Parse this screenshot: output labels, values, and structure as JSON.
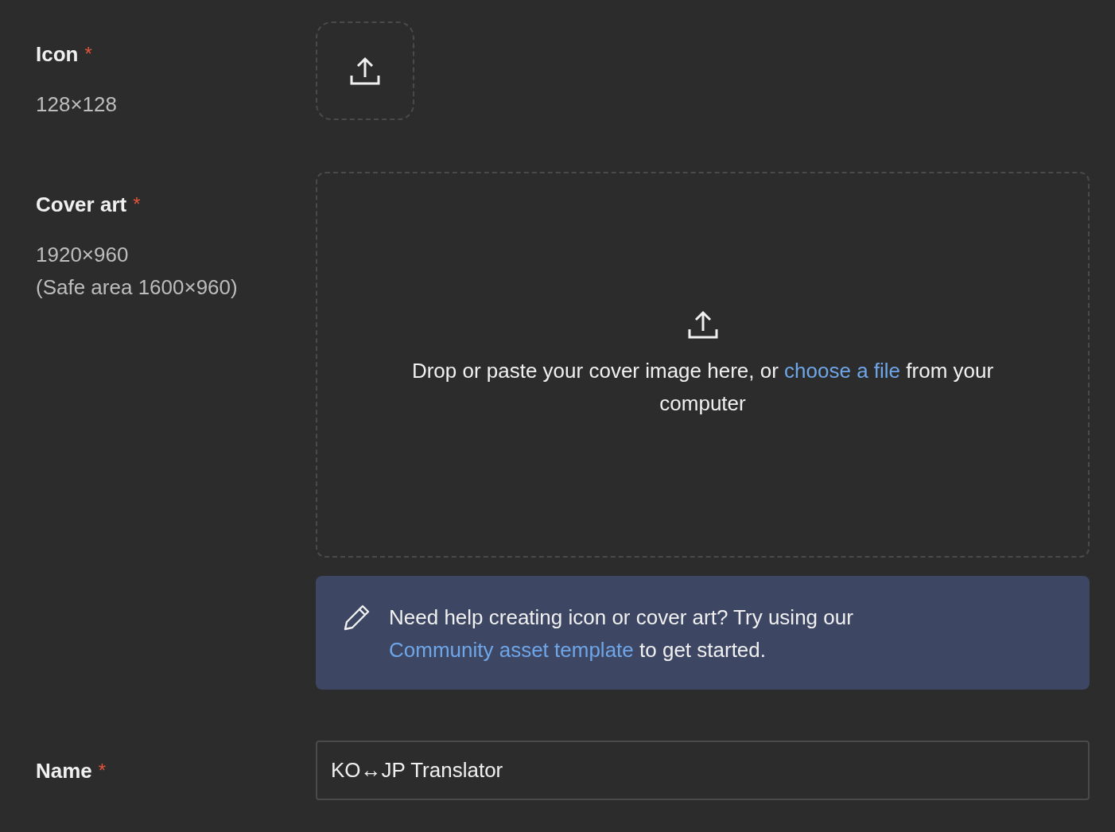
{
  "icon": {
    "label": "Icon",
    "required_mark": "*",
    "hints": [
      "128×128"
    ]
  },
  "cover_art": {
    "label": "Cover art",
    "required_mark": "*",
    "hints": [
      "1920×960",
      "(Safe area 1600×960)"
    ],
    "drop_text_before": "Drop or paste your cover image here, or ",
    "drop_link": "choose a file",
    "drop_text_after": " from your computer"
  },
  "help_banner": {
    "text_before": "Need help creating icon or cover art? Try using our ",
    "link": "Community asset template",
    "text_after": " to get started."
  },
  "name": {
    "label": "Name",
    "required_mark": "*",
    "value": "KO↔JP Translator"
  }
}
